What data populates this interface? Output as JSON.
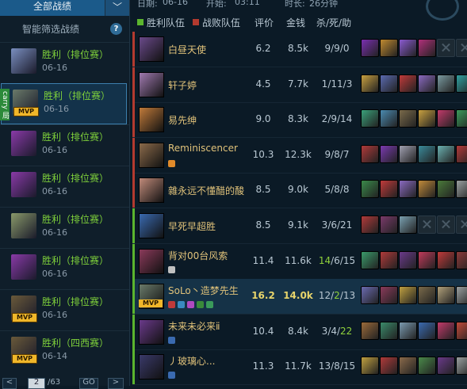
{
  "filter": {
    "label": "全部战绩",
    "arrow": "﹀"
  },
  "smart_filter": {
    "label": "智能筛选战绩",
    "help": "?"
  },
  "carry_tag": "carry 局",
  "matches": [
    {
      "result": "胜利（排位赛）",
      "date": "06-16",
      "mvp": false,
      "color": "#7a8fc0"
    },
    {
      "result": "胜利（排位赛）",
      "date": "06-16",
      "mvp": true,
      "selected": true,
      "color": "#6a7a6a"
    },
    {
      "result": "胜利（排位赛）",
      "date": "06-16",
      "mvp": false,
      "color": "#8a3aa8"
    },
    {
      "result": "胜利（排位赛）",
      "date": "06-16",
      "mvp": false,
      "color": "#8a3aa8"
    },
    {
      "result": "胜利（排位赛）",
      "date": "06-16",
      "mvp": false,
      "color": "#8a9a6a"
    },
    {
      "result": "胜利（排位赛）",
      "date": "06-16",
      "mvp": false,
      "color": "#8a3aa8"
    },
    {
      "result": "胜利（排位赛）",
      "date": "06-16",
      "mvp": true,
      "color": "#6a5a3a"
    },
    {
      "result": "胜利（四西赛）",
      "date": "06-14",
      "mvp": true,
      "color": "#6a5a3a"
    }
  ],
  "mvp_label": "MVP",
  "pager": {
    "prev": "<",
    "current": "2",
    "total": "/63",
    "go": "GO",
    "next": ">"
  },
  "top_info": {
    "date_label": "日期:",
    "date": "06-16",
    "start_label": "开始:",
    "start": "03:11",
    "duration_label": "时长:",
    "duration": "26分钟"
  },
  "headers": {
    "win_team": "胜利队伍",
    "lose_team": "战败队伍",
    "rating": "评价",
    "gold": "金钱",
    "kda": "杀/死/助"
  },
  "win_color": "#5bb52e",
  "lose_color": "#b33a2f",
  "players": [
    {
      "name": "白昼天使",
      "rating": "6.2",
      "gold": "8.5k",
      "kda": "9/9/0",
      "team": "lose",
      "champ_color": "#6a4a8a",
      "items": [
        "#7a2fb0",
        "#c08a30",
        "#8a5ad0",
        "#b0307a",
        "empty",
        "empty"
      ]
    },
    {
      "name": "轩子婷",
      "rating": "4.5",
      "gold": "7.7k",
      "kda": "1/11/3",
      "team": "lose",
      "champ_color": "#a07ab0",
      "items": [
        "#c8a040",
        "#5a6ab0",
        "#c03a3a",
        "#8a6ac0",
        "#7a9aa0",
        "#30a0a0"
      ]
    },
    {
      "name": "易先绅",
      "rating": "9.0",
      "gold": "8.3k",
      "kda": "2/9/14",
      "team": "lose",
      "champ_color": "#c07a3a",
      "items": [
        "#3aa07a",
        "#4a8ab0",
        "#7a6a4a",
        "#c8a040",
        "#c03a6a",
        "#3a9a5a"
      ]
    },
    {
      "name": "Reminiscencer",
      "rating": "10.3",
      "gold": "12.3k",
      "kda": "9/8/7",
      "team": "lose",
      "champ_color": "#8a6a4a",
      "items": [
        "#b03a3a",
        "#7a3ab0",
        "#a0a0b0",
        "#3a8a9a",
        "#6ab0b0",
        "#b03a3a"
      ],
      "icons": [
        "#e08a2a"
      ]
    },
    {
      "name": "雜永远不懂醋的酸",
      "rating": "8.5",
      "gold": "9.0k",
      "kda": "5/8/8",
      "team": "lose",
      "champ_color": "#c08a7a",
      "items": [
        "#3a8a4a",
        "#c03a3a",
        "#8a6ac0",
        "#c08a3a",
        "#4a7a3a",
        "#9aa0a0"
      ]
    },
    {
      "name": "早死早超胜",
      "rating": "8.5",
      "gold": "9.1k",
      "kda": "3/6/21",
      "team": "win",
      "champ_color": "#3a6ab0",
      "items": [
        "#b03a3a",
        "#7a3a6a",
        "#7aa0b0",
        "empty",
        "empty",
        "empty"
      ]
    },
    {
      "name": "背对00台风索",
      "rating": "11.4",
      "gold": "11.6k",
      "kda": "14/6/15",
      "team": "win",
      "champ_color": "#8a3a5a",
      "kda_highlight": "14",
      "items": [
        "#3a9a6a",
        "#b03a3a",
        "#6a3a8a",
        "#c03a5a",
        "#c03a3a",
        "#8a3a3a"
      ],
      "icons": [
        "#c0c0c0"
      ]
    },
    {
      "name": "SoLo丶造梦先生",
      "rating": "16.2",
      "gold": "14.0k",
      "kda": "12/2/13",
      "team": "win",
      "me": true,
      "mvp": true,
      "champ_color": "#6a7a6a",
      "kda_highlight": "2",
      "items": [
        "#6a6ab0",
        "#8a3a5a",
        "#c0a040",
        "#7a6a4a",
        "#b0a07a",
        "#9aa0a0"
      ],
      "icons": [
        "#c03a3a",
        "#3a8ac0",
        "#b04ac0",
        "#3a8a3a",
        "#3a9a5a"
      ]
    },
    {
      "name": "未来未必来ⅱ",
      "rating": "10.4",
      "gold": "8.4k",
      "kda": "3/4/22",
      "team": "win",
      "champ_color": "#6a3a8a",
      "kda_highlight": "22",
      "items": [
        "#9a6a3a",
        "#3a8a6a",
        "#7a9ab0",
        "#3a6ab0",
        "#c03a6a",
        "#c04a3a"
      ],
      "icons": [
        "#3a6ab0"
      ]
    },
    {
      "name": "丿玻璃心...",
      "rating": "11.3",
      "gold": "11.7k",
      "kda": "13/8/15",
      "team": "win",
      "champ_color": "#3a3a6a",
      "items": [
        "#c0a040",
        "#b03a3a",
        "#8a6a4a",
        "#4a8a4a",
        "#6a3a8a",
        "#9aa0a0"
      ],
      "icons": [
        "#3a6ab0"
      ]
    }
  ]
}
